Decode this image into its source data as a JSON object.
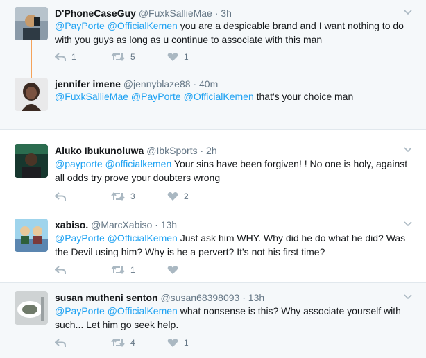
{
  "tweets": [
    {
      "name": "D'PhoneCaseGuy",
      "handle": "@FuxkSallieMae",
      "time": "3h",
      "mentions": [
        "@PayPorte",
        "@OfficialKemen"
      ],
      "text": "you are a despicable brand and I want nothing to do with you guys as long as u continue to associate with this man",
      "replies": "1",
      "retweets": "5",
      "likes": "1",
      "avatar_colors": [
        "#8a9aa8",
        "#2e3a44",
        "#c79a6a"
      ]
    },
    {
      "name": "jennifer imene",
      "handle": "@jennyblaze88",
      "time": "40m",
      "mentions": [
        "@FuxkSallieMae",
        "@PayPorte",
        "@OfficialKemen"
      ],
      "text": "that's your choice man",
      "replies": "",
      "retweets": "",
      "likes": "",
      "avatar_colors": [
        "#e9e9ea",
        "#3b2a22",
        "#7a5240"
      ]
    },
    {
      "name": "Aluko Ibukunoluwa",
      "handle": "@IbkSports",
      "time": "2h",
      "mentions": [
        "@payporte",
        "@officialkemen"
      ],
      "text": "Your sins have been forgiven! ! No one is holy, against all odds try prove your doubters wrong",
      "replies": "",
      "retweets": "3",
      "likes": "2",
      "avatar_colors": [
        "#17372e",
        "#2b6c4f",
        "#1e1e22"
      ]
    },
    {
      "name": "xabiso.",
      "handle": "@MarcXabiso",
      "time": "13h",
      "mentions": [
        "@PayPorte",
        "@OfficialKemen"
      ],
      "text": "Just ask him WHY. Why did he do what he did? Was the Devil using him? Why is he a pervert? It's not his first time?",
      "replies": "",
      "retweets": "1",
      "likes": "",
      "avatar_colors": [
        "#9fd4ec",
        "#e8c89a",
        "#5b86b0"
      ]
    },
    {
      "name": "susan mutheni senton",
      "handle": "@susan68398093",
      "time": "13h",
      "mentions": [
        "@PayPorte",
        "@OfficialKemen"
      ],
      "text": "what nonsense is this?  Why associate yourself with such... Let him go seek help.",
      "replies": "",
      "retweets": "4",
      "likes": "1",
      "avatar_colors": [
        "#cfd3d4",
        "#6f7a6a",
        "#ffffff"
      ]
    }
  ],
  "separator_dot": "·",
  "colors": {
    "link": "#1da1f2",
    "muted": "#657786",
    "icon": "#aab8c2",
    "thread_line": "#f5a35a",
    "thread_bg": "#f5f8fa",
    "border": "#e1e8ed"
  }
}
